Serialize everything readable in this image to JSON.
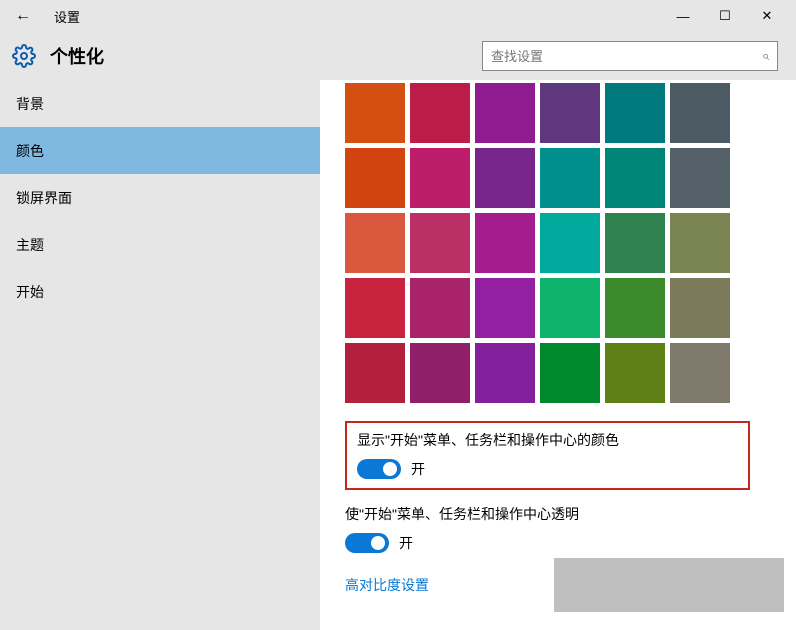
{
  "titlebar": {
    "title": "设置"
  },
  "header": {
    "title": "个性化",
    "search_placeholder": "查找设置"
  },
  "sidebar": {
    "items": [
      {
        "label": "背景"
      },
      {
        "label": "颜色"
      },
      {
        "label": "锁屏界面"
      },
      {
        "label": "主题"
      },
      {
        "label": "开始"
      }
    ],
    "active_index": 1
  },
  "palette": {
    "colors": [
      "#d45012",
      "#bc1c48",
      "#8e1b8f",
      "#5f377e",
      "#007a7c",
      "#4b5a63",
      "#d14410",
      "#bc1d6a",
      "#78258c",
      "#008f8c",
      "#008579",
      "#556168",
      "#d9583d",
      "#ba2f66",
      "#a31d8e",
      "#00a99b",
      "#2f814e",
      "#7a8452",
      "#c7233e",
      "#a8236a",
      "#9320a0",
      "#0fb36b",
      "#3b8b2d",
      "#7b7a5a",
      "#b2203d",
      "#8f1f68",
      "#82219b",
      "#008a2d",
      "#5f7f17",
      "#807a6c"
    ]
  },
  "settings": {
    "accent_on_start": {
      "label": "显示\"开始\"菜单、任务栏和操作中心的颜色",
      "state": "开"
    },
    "transparency": {
      "label": "使\"开始\"菜单、任务栏和操作中心透明",
      "state": "开"
    },
    "high_contrast_link": "高对比度设置"
  }
}
